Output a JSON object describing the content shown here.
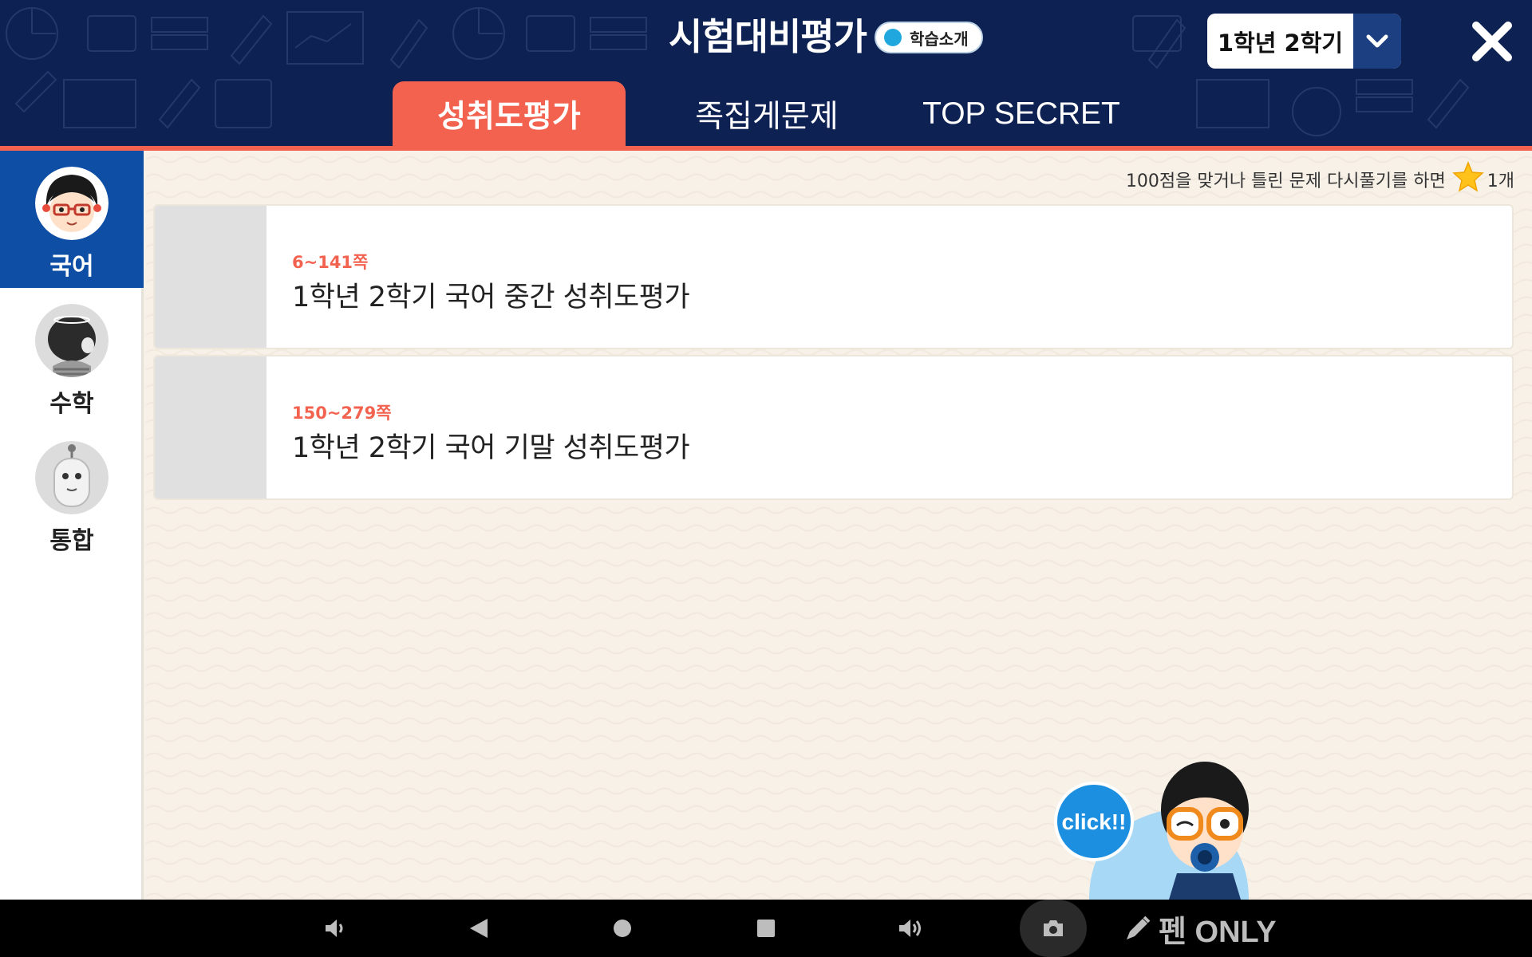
{
  "header": {
    "title": "시험대비평가",
    "intro_label": "학습소개",
    "semester": "1학년 2학기",
    "tabs": [
      {
        "label": "성취도평가",
        "active": true
      },
      {
        "label": "족집게문제",
        "active": false
      },
      {
        "label": "TOP SECRET",
        "active": false
      }
    ]
  },
  "sidebar": {
    "items": [
      {
        "label": "국어",
        "active": true
      },
      {
        "label": "수학",
        "active": false
      },
      {
        "label": "통합",
        "active": false
      }
    ]
  },
  "main": {
    "note": "100점을 맞거나 틀린 문제 다시풀기를 하면",
    "note_reward": "1개",
    "cards": [
      {
        "pages": "6~141쪽",
        "title": "1학년 2학기 국어 중간 성취도평가"
      },
      {
        "pages": "150~279쪽",
        "title": "1학년 2학기 국어 기말 성취도평가"
      }
    ],
    "mascot_label": "click!!"
  },
  "system_bar": {
    "pen_label": "펜 ONLY"
  },
  "colors": {
    "header_bg": "#0d2152",
    "accent": "#f2624f",
    "sidebar_active": "#0e4ea4",
    "intro_dot": "#20a8de"
  },
  "icons": [
    "chevron-down-icon",
    "close-icon",
    "star-icon",
    "volume-down-icon",
    "back-icon",
    "home-icon",
    "recents-icon",
    "volume-up-icon",
    "camera-icon",
    "pencil-icon"
  ]
}
